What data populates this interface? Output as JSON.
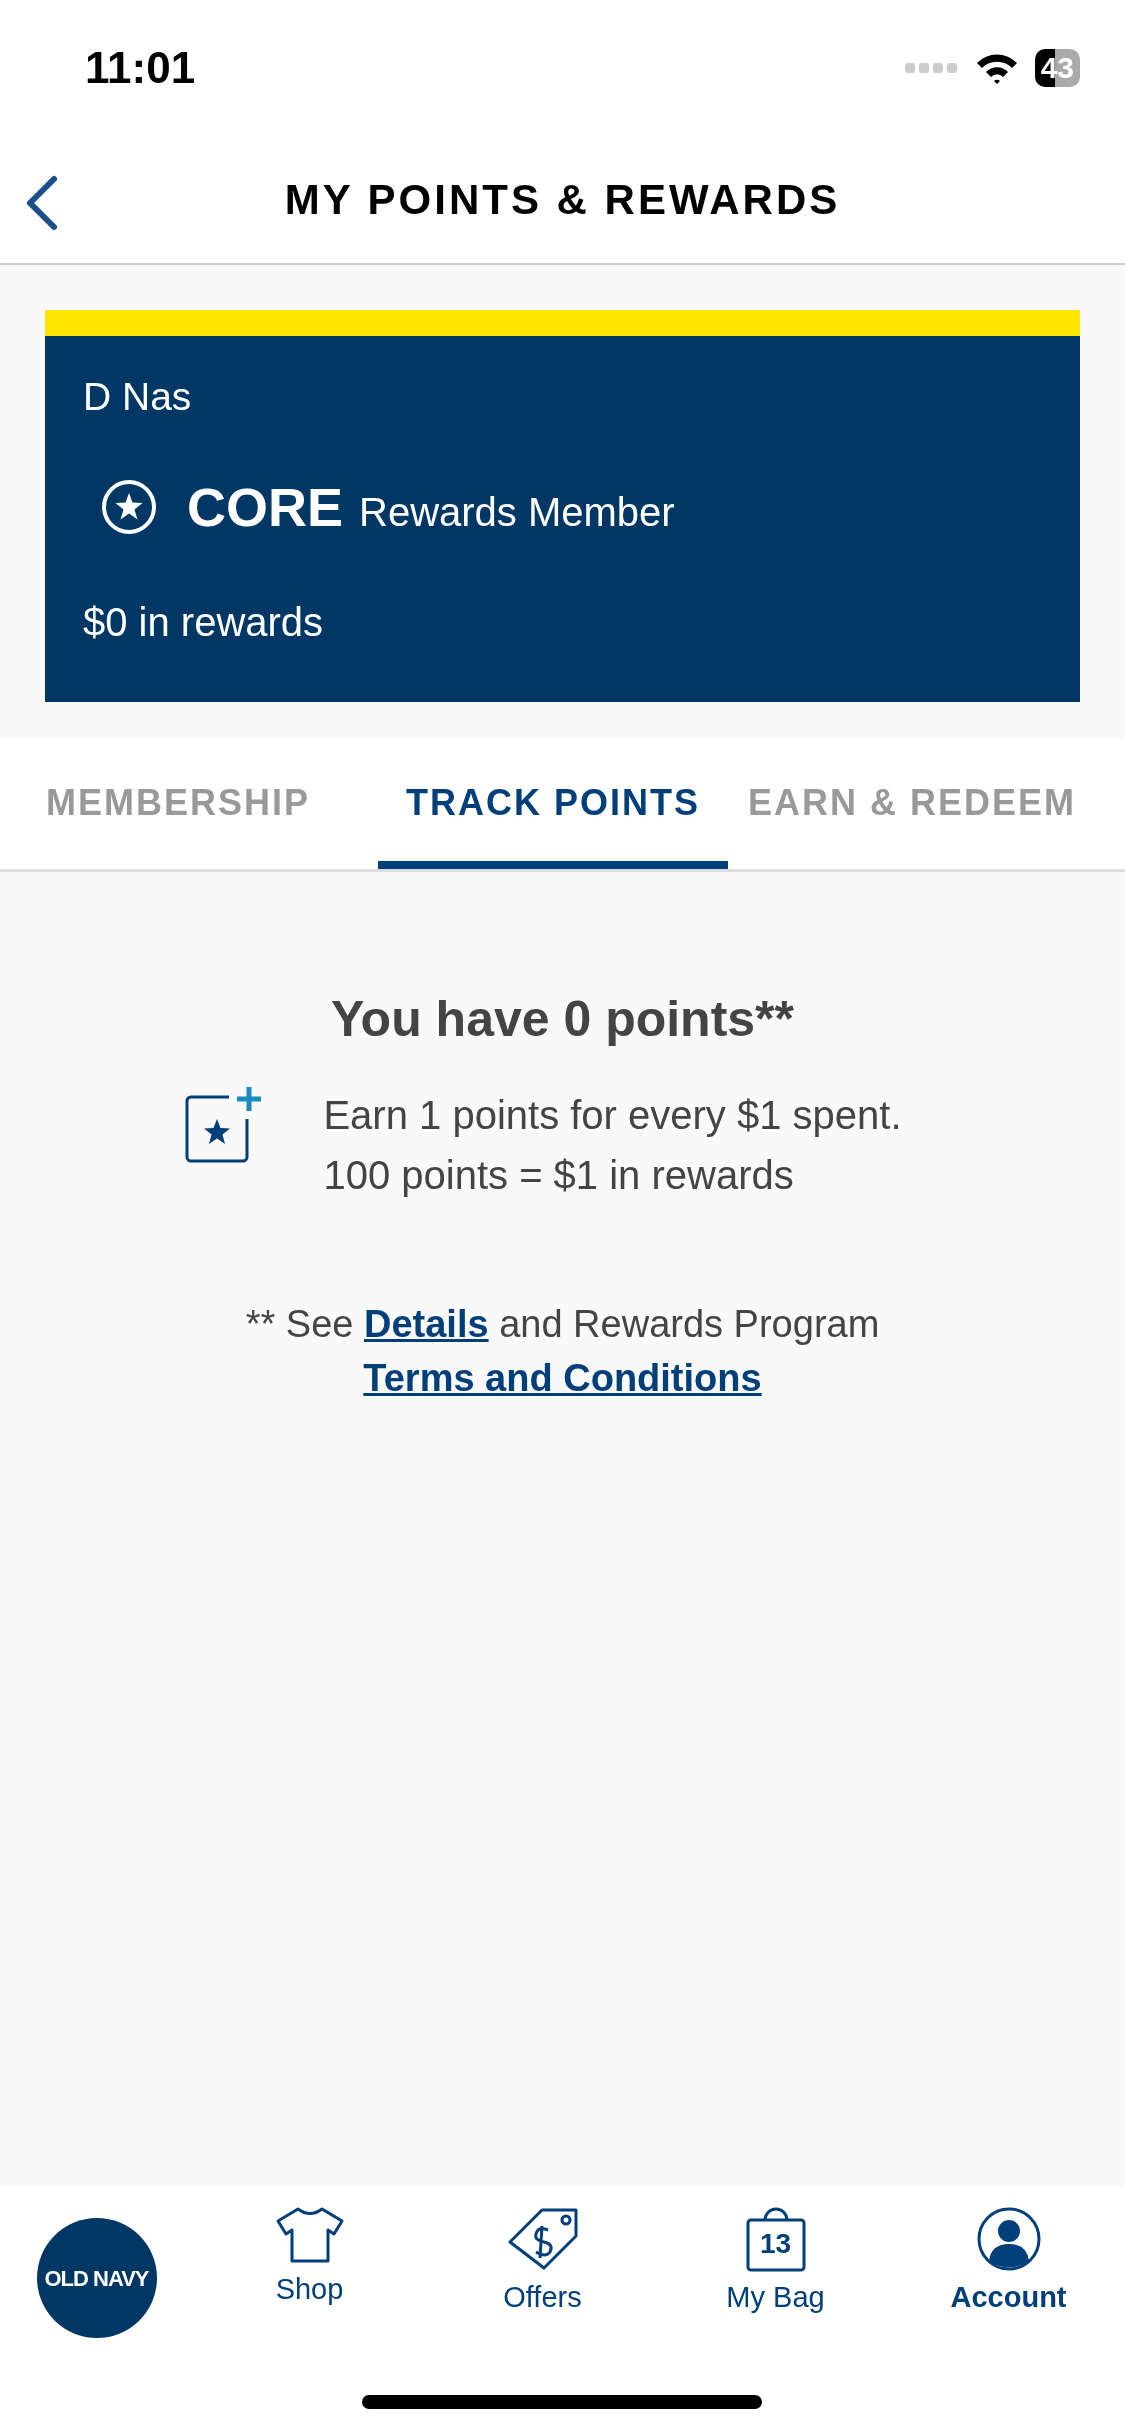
{
  "status_bar": {
    "time": "11:01",
    "battery": "43"
  },
  "header": {
    "title": "MY POINTS & REWARDS"
  },
  "member_card": {
    "name": "D Nas",
    "tier": "CORE",
    "tier_label": "Rewards Member",
    "rewards": "$0 in rewards"
  },
  "tabs": [
    {
      "label": "MEMBERSHIP",
      "selected": false
    },
    {
      "label": "TRACK POINTS",
      "selected": true
    },
    {
      "label": "EARN & REDEEM",
      "selected": false
    }
  ],
  "points": {
    "heading": "You have 0 points**",
    "lines": [
      "Earn 1 points for every $1 spent.",
      "100 points = $1 in rewards"
    ],
    "footnote": [
      {
        "kind": "text",
        "text": "** See "
      },
      {
        "kind": "link",
        "text": "Details"
      },
      {
        "kind": "text",
        "text": " and Rewards Program "
      },
      {
        "kind": "link",
        "text": "Terms and Conditions"
      }
    ]
  },
  "bottom_nav": [
    {
      "kind": "logo",
      "label": "OLD NAVY",
      "selected": false
    },
    {
      "kind": "shop",
      "label": "Shop",
      "selected": false
    },
    {
      "kind": "offers",
      "label": "Offers",
      "selected": false
    },
    {
      "kind": "bag",
      "label": "My Bag",
      "count": "13",
      "selected": false
    },
    {
      "kind": "account",
      "label": "Account",
      "selected": true
    }
  ]
}
